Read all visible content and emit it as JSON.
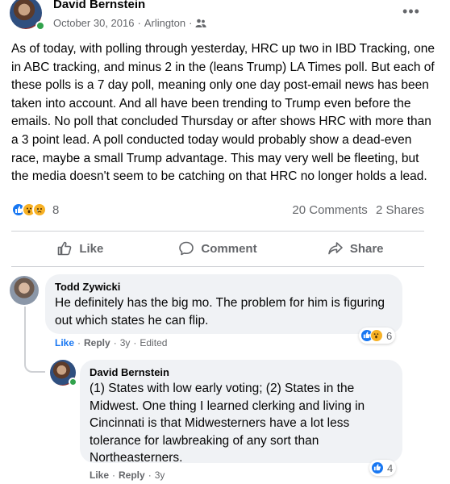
{
  "post": {
    "author": "David Bernstein",
    "date": "October 30, 2016",
    "separator": "·",
    "location": "Arlington",
    "more_icon": "•••",
    "body": "As of today, with polling through yesterday, HRC up two in IBD Tracking, one in ABC tracking, and minus 2 in the (leans Trump) LA Times poll. But each of these polls is a 7 day poll, meaning only one day post-email news has been taken into account. And all have been trending to Trump even before the emails. No poll that concluded Thursday or after shows HRC with more than a 3 point lead. A poll conducted today would probably show a dead-even race, maybe a small Trump advantage. This may very well be fleeting, but the media doesn't seem to be catching on that HRC no longer holds a lead.",
    "reaction_count": "8",
    "comments": "20 Comments",
    "shares": "2 Shares",
    "reaction_icons": [
      "like-icon",
      "wow-icon",
      "sad-icon"
    ]
  },
  "actions": {
    "like": "Like",
    "comment": "Comment",
    "share": "Share"
  },
  "comments": [
    {
      "author": "Todd Zywicki",
      "text": "He definitely has the big mo. The problem for him is figuring out which states he can flip.",
      "like": "Like",
      "reply": "Reply",
      "age": "3y",
      "edited": "Edited",
      "reaction_count": "6"
    },
    {
      "author": "David Bernstein",
      "text": "(1) States with low early voting; (2) States in the Midwest. One thing I learned clerking and living in Cincinnati is that Midwesterners have a lot less tolerance for lawbreaking of any sort than Northeasterners.",
      "like": "Like",
      "reply": "Reply",
      "age": "3y",
      "reaction_count": "4"
    }
  ],
  "colors": {
    "accent": "#1877f2",
    "secondary_text": "#65676b",
    "bubble": "#f0f2f5",
    "online": "#31a24c",
    "wow": "#f7b125"
  }
}
